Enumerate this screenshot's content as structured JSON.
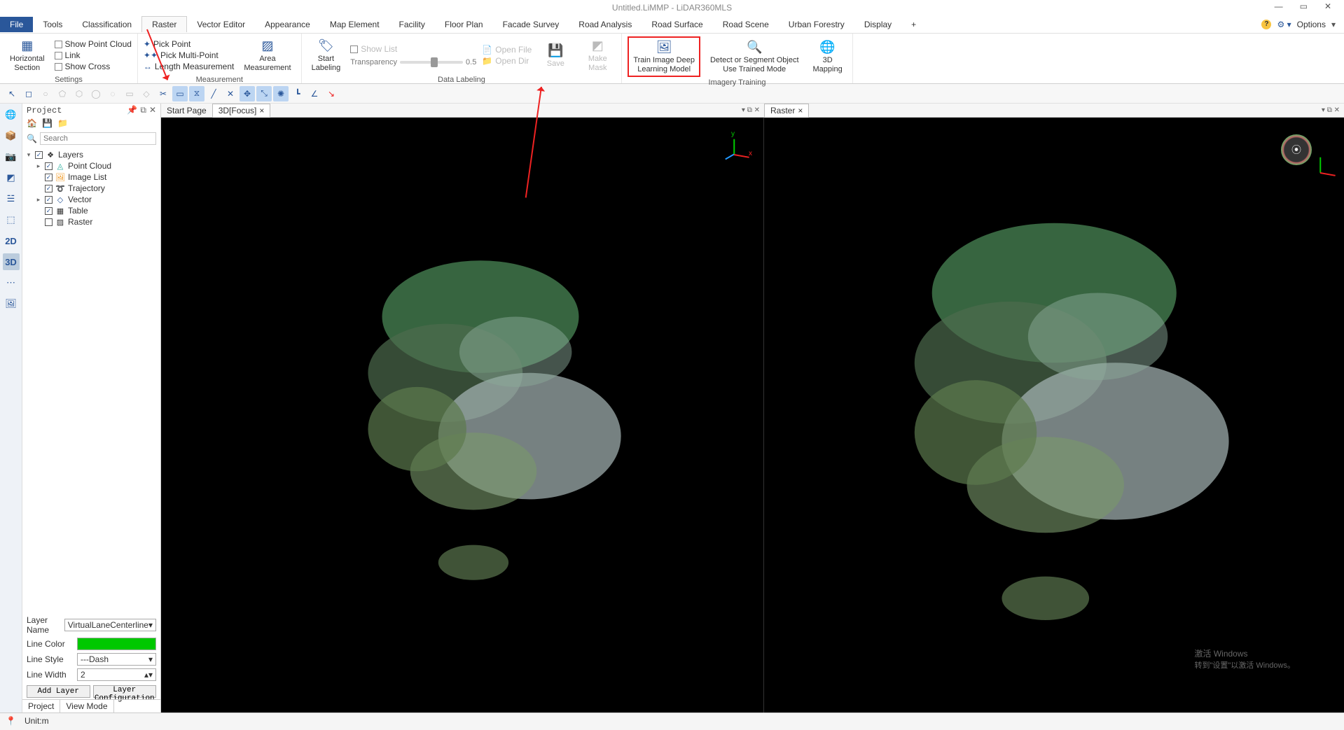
{
  "title": "Untitled.LiMMP - LiDAR360MLS",
  "menu": {
    "file": "File",
    "items": [
      "Tools",
      "Classification",
      "Raster",
      "Vector Editor",
      "Appearance",
      "Map Element",
      "Facility",
      "Floor Plan",
      "Facade Survey",
      "Road Analysis",
      "Road Surface",
      "Road Scene",
      "Urban Forestry",
      "Display",
      "+"
    ],
    "options": "Options"
  },
  "ribbon": {
    "settings": {
      "label": "Settings",
      "horizontal_section": "Horizontal\nSection",
      "show_point_cloud": "Show Point Cloud",
      "link": "Link",
      "show_cross": "Show Cross"
    },
    "measurement": {
      "label": "Measurement",
      "pick_point": "Pick Point",
      "pick_multi": "Pick Multi-Point",
      "length": "Length Measurement",
      "area": "Area\nMeasurement"
    },
    "data_labeling": {
      "label": "Data Labeling",
      "start_labeling": "Start\nLabeling",
      "show_list": "Show List",
      "transparency": "Transparency",
      "trans_val": "0.5",
      "open_file": "Open File",
      "open_dir": "Open Dir",
      "save": "Save",
      "make_mask": "Make\nMask"
    },
    "imagery": {
      "label": "Imagery Training",
      "train": "Train Image Deep\nLearning Model",
      "detect": "Detect or Segment Object\nUse Trained Mode",
      "mapping": "3D\nMapping"
    }
  },
  "panel": {
    "header": "Project",
    "search_placeholder": "Search",
    "layers_root": "Layers",
    "layers": [
      "Point Cloud",
      "Image List",
      "Trajectory",
      "Vector",
      "Table",
      "Raster"
    ],
    "props": {
      "layer_name_lbl": "Layer Name",
      "layer_name_val": "VirtualLaneCenterline",
      "line_color_lbl": "Line Color",
      "line_style_lbl": "Line Style",
      "line_style_val": "---Dash",
      "line_width_lbl": "Line Width",
      "line_width_val": "2"
    },
    "add_layer": "Add Layer",
    "layer_config": "Layer Configuration",
    "tab_project": "Project",
    "tab_viewmode": "View Mode"
  },
  "viewer": {
    "start_page": "Start Page",
    "focus3d": "3D[Focus]",
    "raster": "Raster",
    "close_x": "×",
    "dock_icons": "▾ ⧉ ✕"
  },
  "status": {
    "unit": "Unit:m"
  },
  "watermark": {
    "line1": "激活 Windows",
    "line2": "转到\"设置\"以激活 Windows。"
  },
  "colors": {
    "accent": "#2a579a",
    "highlight": "#e22"
  }
}
